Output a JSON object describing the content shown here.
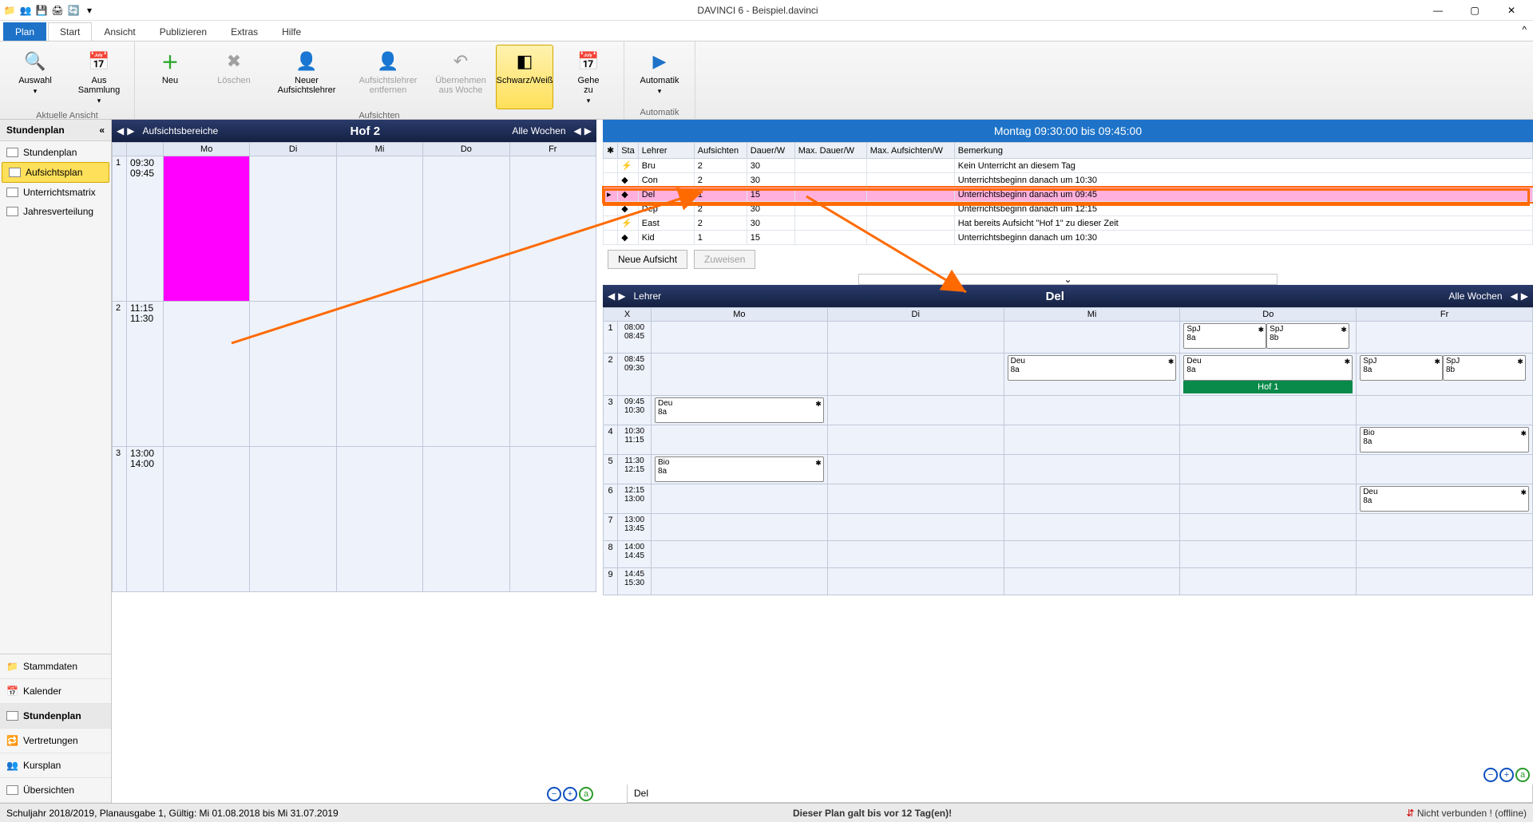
{
  "window": {
    "title": "DAVINCI 6 - Beispiel.davinci"
  },
  "ribbon_tabs": {
    "plan": "Plan",
    "start": "Start",
    "ansicht": "Ansicht",
    "publizieren": "Publizieren",
    "extras": "Extras",
    "hilfe": "Hilfe"
  },
  "ribbon": {
    "group1": {
      "auswahl": "Auswahl",
      "aus_sammlung": "Aus\nSammlung",
      "caption": "Aktuelle Ansicht"
    },
    "group2": {
      "neu": "Neu",
      "loeschen": "Löschen",
      "neuer_aufsichtslehrer": "Neuer\nAufsichtslehrer",
      "aufsichtslehrer_entfernen": "Aufsichtslehrer\nentfernen",
      "uebernehmen": "Übernehmen\naus Woche",
      "schwarz_weiss": "Schwarz/Weiß",
      "gehe_zu": "Gehe\nzu",
      "caption": "Aufsichten"
    },
    "group3": {
      "automatik": "Automatik",
      "caption": "Automatik"
    }
  },
  "leftnav": {
    "title": "Stundenplan",
    "items": {
      "stundenplan": "Stundenplan",
      "aufsichtsplan": "Aufsichtsplan",
      "unterrichtsmatrix": "Unterrichtsmatrix",
      "jahresverteilung": "Jahresverteilung"
    },
    "bottom": {
      "stammdaten": "Stammdaten",
      "kalender": "Kalender",
      "stundenplan": "Stundenplan",
      "vertretungen": "Vertretungen",
      "kursplan": "Kursplan",
      "uebersichten": "Übersichten"
    }
  },
  "left_panel": {
    "section_label": "Aufsichtsbereiche",
    "title": "Hof 2",
    "weeks": "Alle Wochen",
    "days": {
      "mo": "Mo",
      "di": "Di",
      "mi": "Mi",
      "do": "Do",
      "fr": "Fr"
    },
    "rows": [
      {
        "n": "1",
        "t1": "09:30",
        "t2": "09:45"
      },
      {
        "n": "2",
        "t1": "11:15",
        "t2": "11:30"
      },
      {
        "n": "3",
        "t1": "13:00",
        "t2": "14:00"
      }
    ]
  },
  "right_header": "Montag 09:30:00 bis 09:45:00",
  "teacher_table": {
    "cols": {
      "marker": "✱",
      "status": "Sta",
      "lehrer": "Lehrer",
      "aufsichten": "Aufsichten",
      "dauer": "Dauer/W",
      "maxdauer": "Max. Dauer/W",
      "maxauf": "Max. Aufsichten/W",
      "bemerkung": "Bemerkung"
    },
    "rows": [
      {
        "icon": "⚡",
        "lehrer": "Bru",
        "aufsichten": "2",
        "dauer": "30",
        "bemerkung": "Kein Unterricht an diesem Tag"
      },
      {
        "icon": "◆",
        "lehrer": "Con",
        "aufsichten": "2",
        "dauer": "30",
        "bemerkung": "Unterrichtsbeginn danach um 10:30"
      },
      {
        "icon": "◆",
        "lehrer": "Del",
        "aufsichten": "1",
        "dauer": "15",
        "bemerkung": "Unterrichtsbeginn danach um 09:45",
        "selected": true
      },
      {
        "icon": "◆",
        "lehrer": "Dep",
        "aufsichten": "2",
        "dauer": "30",
        "bemerkung": "Unterrichtsbeginn danach um 12:15"
      },
      {
        "icon": "⚡",
        "lehrer": "East",
        "aufsichten": "2",
        "dauer": "30",
        "bemerkung": "Hat bereits Aufsicht \"Hof 1\" zu dieser Zeit"
      },
      {
        "icon": "◆",
        "lehrer": "Kid",
        "aufsichten": "1",
        "dauer": "15",
        "bemerkung": "Unterrichtsbeginn danach um 10:30"
      }
    ],
    "btn_neu": "Neue Aufsicht",
    "btn_zuweisen": "Zuweisen"
  },
  "plan2": {
    "section_label": "Lehrer",
    "title": "Del",
    "weeks": "Alle Wochen",
    "colX": "X",
    "days": {
      "mo": "Mo",
      "di": "Di",
      "mi": "Mi",
      "do": "Do",
      "fr": "Fr"
    },
    "rows": [
      {
        "n": "1",
        "t1": "08:00",
        "t2": "08:45"
      },
      {
        "n": "2",
        "t1": "08:45",
        "t2": "09:30"
      },
      {
        "n": "3",
        "t1": "09:45",
        "t2": "10:30"
      },
      {
        "n": "4",
        "t1": "10:30",
        "t2": "11:15"
      },
      {
        "n": "5",
        "t1": "11:30",
        "t2": "12:15"
      },
      {
        "n": "6",
        "t1": "12:15",
        "t2": "13:00"
      },
      {
        "n": "7",
        "t1": "13:00",
        "t2": "13:45"
      },
      {
        "n": "8",
        "t1": "14:00",
        "t2": "14:45"
      },
      {
        "n": "9",
        "t1": "14:45",
        "t2": "15:30"
      }
    ],
    "lessons": {
      "spj": "SpJ",
      "8a": "8a",
      "8b": "8b",
      "deu": "Deu",
      "bio": "Bio",
      "hof1": "Hof 1"
    },
    "bottom_tab": "Del"
  },
  "statusbar": {
    "left": "Schuljahr 2018/2019, Planausgabe 1, Gültig: Mi 01.08.2018 bis Mi 31.07.2019",
    "mid": "Dieser Plan galt bis vor 12 Tag(en)!",
    "right": "Nicht verbunden ! (offline)"
  }
}
